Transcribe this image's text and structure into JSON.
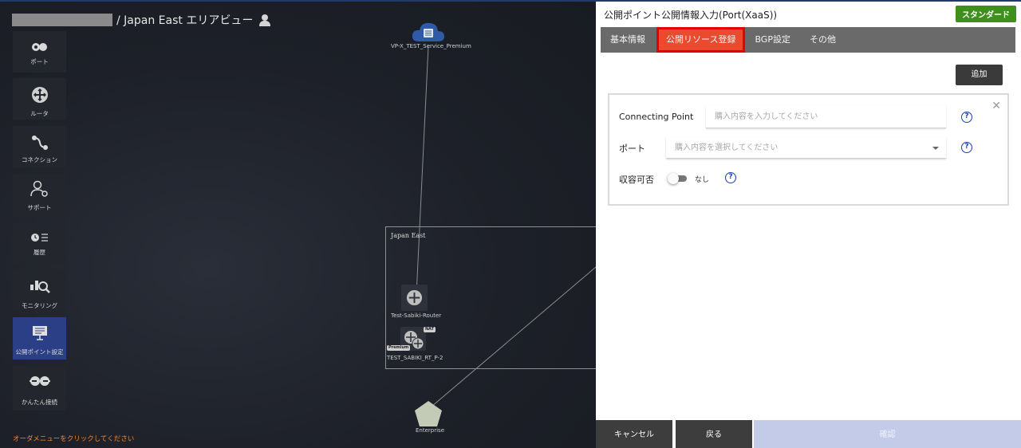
{
  "canvas": {
    "breadcrumb": "/ Japan East エリアビュー",
    "menu": [
      {
        "label": "ポート",
        "icon": "port-icon"
      },
      {
        "label": "ルータ",
        "icon": "router-icon"
      },
      {
        "label": "コネクション",
        "icon": "connection-icon"
      },
      {
        "label": "サポート",
        "icon": "support-icon"
      },
      {
        "label": "履歴",
        "icon": "history-icon"
      },
      {
        "label": "モニタリング",
        "icon": "monitoring-icon"
      },
      {
        "label": "公開ポイント設定",
        "icon": "public-point-icon"
      },
      {
        "label": "かんたん接続",
        "icon": "easy-connect-icon"
      }
    ],
    "hint": "オーダメニューをクリックしてください",
    "nodes": {
      "service": "VP-X_TEST_Service_Premium",
      "area": "Japan East",
      "router1": "Test-Sabiki-Router",
      "router2": "TEST_SABIKI_RT_P-2",
      "nat_tag": "NAT",
      "premium_tag": "Premium",
      "enterprise": "Enterprise"
    }
  },
  "panel": {
    "title": "公開ポイント公開情報入力(Port(XaaS))",
    "badge": "スタンダード",
    "tabs": [
      {
        "label": "基本情報",
        "active": false
      },
      {
        "label": "公開リソース登録",
        "active": true
      },
      {
        "label": "BGP設定",
        "active": false
      },
      {
        "label": "その他",
        "active": false
      }
    ],
    "add_label": "追加",
    "form": {
      "connecting_point_label": "Connecting Point",
      "connecting_point_placeholder": "購入内容を入力してください",
      "port_label": "ポート",
      "port_placeholder": "購入内容を選択してください",
      "capacity_label": "収容可否",
      "capacity_value": "なし"
    },
    "footer": {
      "cancel": "キャンセル",
      "back": "戻る",
      "confirm": "確認"
    }
  },
  "colors": {
    "accent_blue": "#2b3f86",
    "tab_active": "#ea4a2e",
    "badge_green": "#3f8f1c",
    "confirm_disabled": "#c3cbe9",
    "hint_orange": "#f08a2a"
  }
}
